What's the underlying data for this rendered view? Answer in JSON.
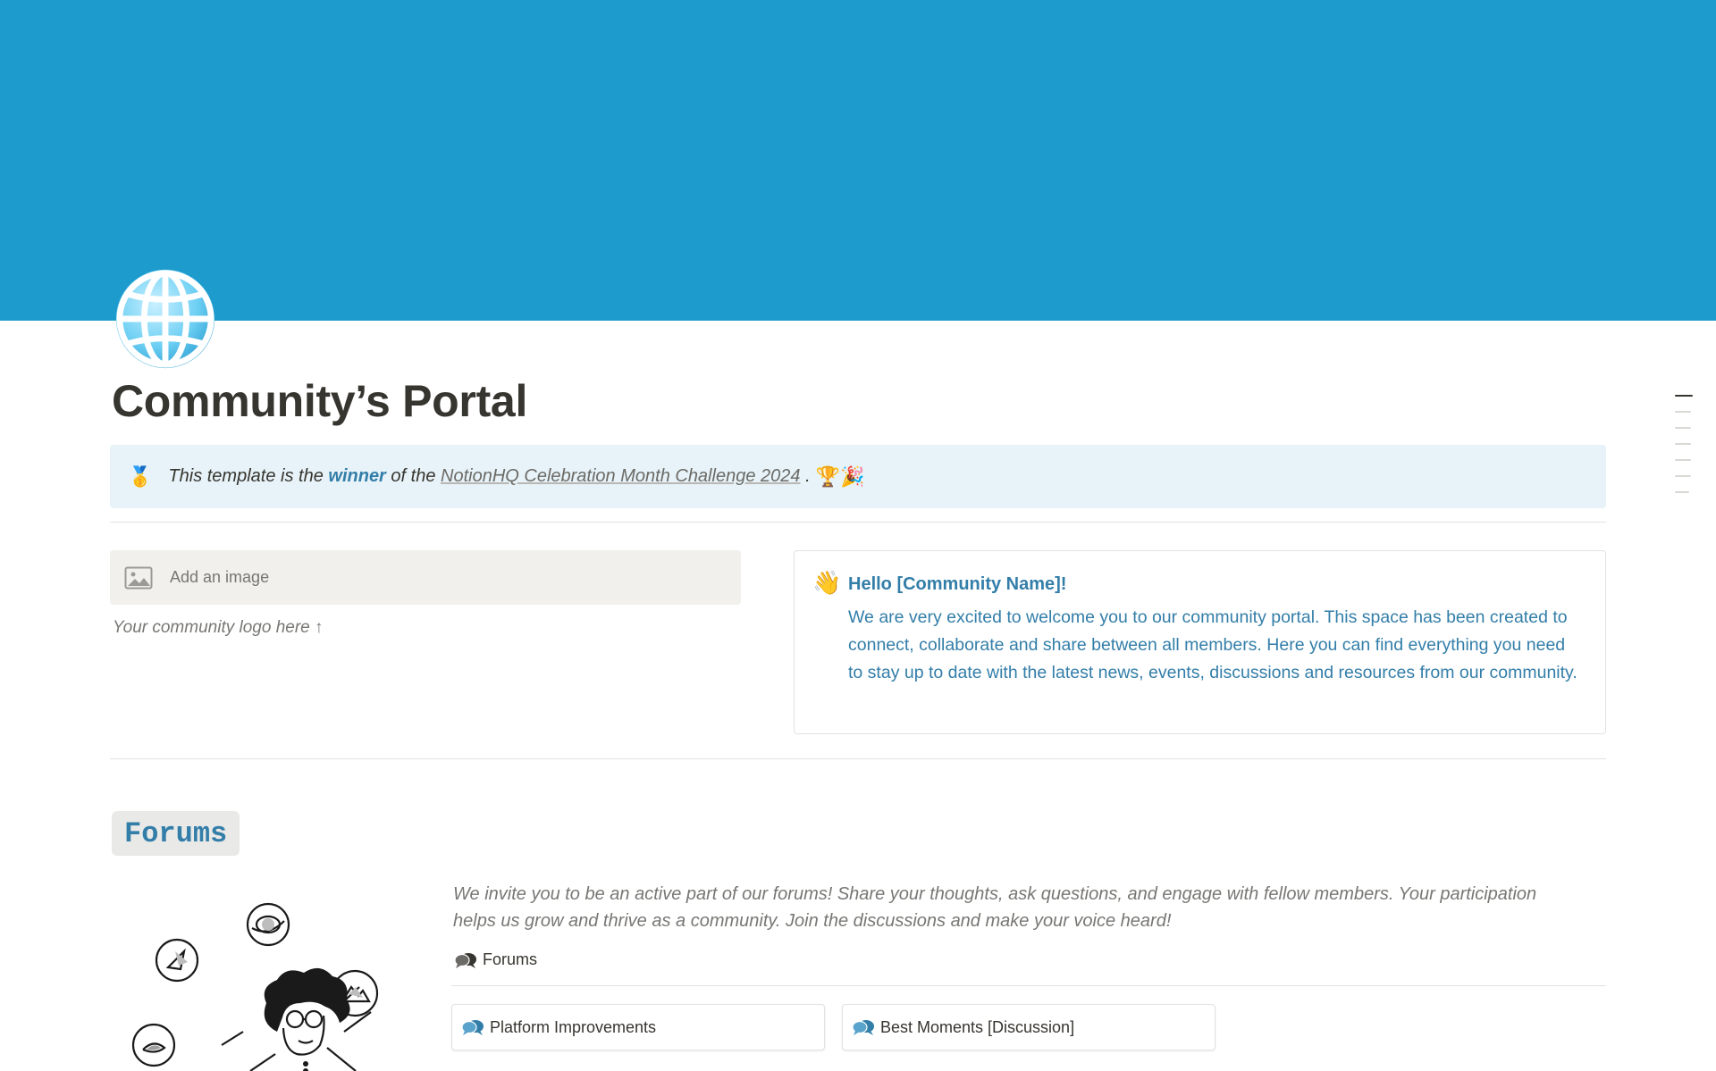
{
  "cover": {
    "color": "#1e9bcd"
  },
  "page": {
    "icon": "globe-icon",
    "title": "Community’s Portal"
  },
  "callout": {
    "icon": "medal-icon",
    "text_before": "This template is the",
    "highlight": "winner",
    "text_middle": "of the",
    "link_text": "NotionHQ Celebration Month Challenge 2024",
    "text_after": ".",
    "emoji": "🏆🎉"
  },
  "logo_block": {
    "add_image_label": "Add an image",
    "caption": "Your community logo here ↑"
  },
  "welcome": {
    "icon": "waving-hand-icon",
    "heading": "Hello [Community Name]!",
    "body": "We are very excited to welcome you to our community portal. This space has been created to connect, collaborate and share between all members. Here you can find everything you need to stay up to date with the latest news, events, discussions and resources from our community."
  },
  "forums": {
    "heading": "Forums",
    "intro": "We invite you to be an active part of our forums! Share your thoughts, ask questions, and engage with fellow members. Your participation helps us grow and thrive as a community. Join the discussions and make your voice heard!",
    "link_label": "Forums",
    "cards": [
      {
        "label": "Platform Improvements",
        "icon": "speech-bubbles-icon"
      },
      {
        "label": "Best Moments [Discussion]",
        "icon": "speech-bubbles-icon"
      }
    ]
  },
  "colors": {
    "accent": "#337ea9",
    "callout_bg": "#e7f3f8",
    "text": "#37352f",
    "muted": "#787774"
  }
}
